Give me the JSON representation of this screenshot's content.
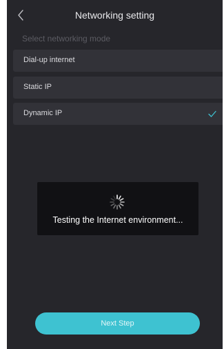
{
  "header": {
    "title": "Networking setting",
    "back_icon": "chevron-left-icon"
  },
  "section_label": "Select networking mode",
  "options": [
    {
      "label": "Dial-up internet",
      "selected": false
    },
    {
      "label": "Static IP",
      "selected": false
    },
    {
      "label": "Dynamic IP",
      "selected": true,
      "check_icon": "checkmark-icon"
    }
  ],
  "toast": {
    "spinner_icon": "loading-spinner-icon",
    "message": "Testing the Internet environment..."
  },
  "next_button": {
    "label": "Next Step"
  },
  "colors": {
    "background": "#26262b",
    "option_background": "#323238",
    "accent": "#3ec2d1",
    "toast_background": "#111114"
  }
}
